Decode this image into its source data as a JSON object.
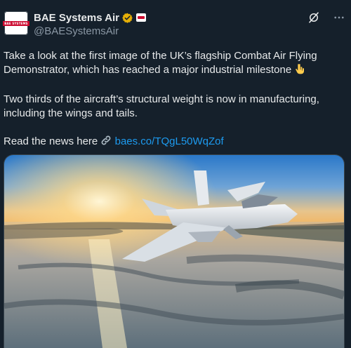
{
  "account": {
    "display_name": "BAE Systems Air",
    "handle": "@BAESystemsAir",
    "avatar_text": "BAE SYSTEMS"
  },
  "post": {
    "paragraph1": "Take a look at the first image of the UK’s flagship Combat Air Flying Demonstrator, which has reached a major industrial milestone",
    "paragraph1_emoji": "point-down-icon",
    "paragraph2": "Two thirds of the aircraft’s structural weight is now in manufacturing, including the wings and tails.",
    "paragraph3_prefix": "Read the news here",
    "paragraph3_emoji": "link-icon",
    "link_text": "baes.co/TQgL50WqZof"
  },
  "colors": {
    "background": "#15202b",
    "text": "#e7e9ea",
    "secondary_text": "#8b98a5",
    "link": "#1d9bf0",
    "verified_badge": "#e7b007"
  },
  "icons": {
    "verified": "verified-gold-badge-icon",
    "affiliate": "affiliate-badge-icon",
    "grok": "grok-icon",
    "more": "more-options-icon"
  }
}
